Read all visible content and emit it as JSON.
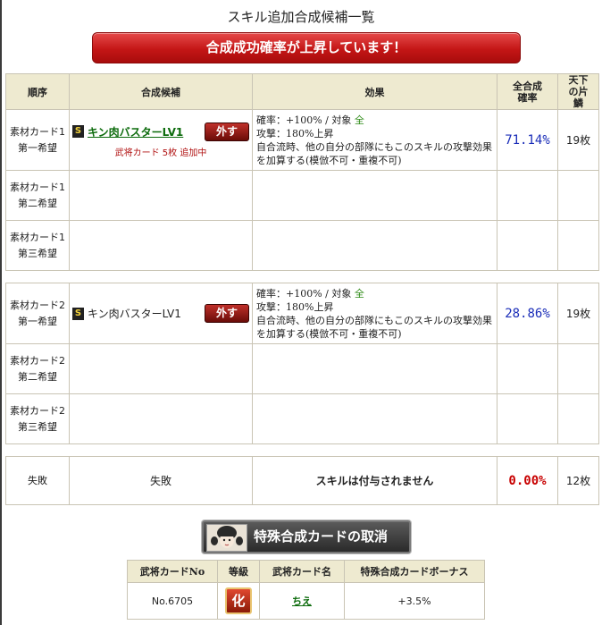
{
  "page_title": "スキル追加合成候補一覧",
  "banner": "合成成功確率が上昇しています！",
  "headers": {
    "order": "順序",
    "candidate": "合成候補",
    "effect": "効果",
    "total_rate": "全合成確率",
    "tenka": "天下の片鱗"
  },
  "card1": {
    "hope1": {
      "order_line1": "素材カード1",
      "order_line2": "第一希望",
      "skill_rank": "S",
      "skill_name": "キン肉バスターLV1",
      "remove_label": "外す",
      "adding_note": "武将カード 5枚 追加中",
      "effect_line1_pre": "確率：+100%  /  対象 ",
      "effect_target": "全",
      "effect_line2": "攻撃：180%上昇",
      "effect_line3": "自合流時、他の自分の部隊にもこのスキルの攻撃効果を加算する(模倣不可・重複不可)",
      "rate": "71.14%",
      "tenka_count": "19枚"
    },
    "hope2": {
      "order_line1": "素材カード1",
      "order_line2": "第二希望"
    },
    "hope3": {
      "order_line1": "素材カード1",
      "order_line2": "第三希望"
    }
  },
  "card2": {
    "hope1": {
      "order_line1": "素材カード2",
      "order_line2": "第一希望",
      "skill_rank": "S",
      "skill_name": "キン肉バスターLV1",
      "remove_label": "外す",
      "effect_line1_pre": "確率：+100%  /  対象 ",
      "effect_target": "全",
      "effect_line2": "攻撃：180%上昇",
      "effect_line3": "自合流時、他の自分の部隊にもこのスキルの攻撃効果を加算する(模倣不可・重複不可)",
      "rate": "28.86%",
      "tenka_count": "19枚"
    },
    "hope2": {
      "order_line1": "素材カード2",
      "order_line2": "第二希望"
    },
    "hope3": {
      "order_line1": "素材カード2",
      "order_line2": "第三希望"
    }
  },
  "failure": {
    "order": "失敗",
    "candidate": "失敗",
    "effect": "スキルは付与されません",
    "rate": "0.00%",
    "tenka_count": "12枚"
  },
  "cancel_button": "特殊合成カードの取消",
  "special_table": {
    "headers": {
      "card_no": "武将カードNo",
      "rank": "等級",
      "card_name": "武将カード名",
      "bonus": "特殊合成カードボーナス"
    },
    "row": {
      "card_no": "No.6705",
      "rank": "化",
      "card_name": "ちえ",
      "bonus": "+3.5%"
    }
  },
  "colors": {
    "banner_red": "#c41616",
    "header_bg": "#eeead0",
    "skill_link_green": "#0c6b0c",
    "rate_blue": "#1a2db8",
    "fail_red": "#c80000"
  }
}
